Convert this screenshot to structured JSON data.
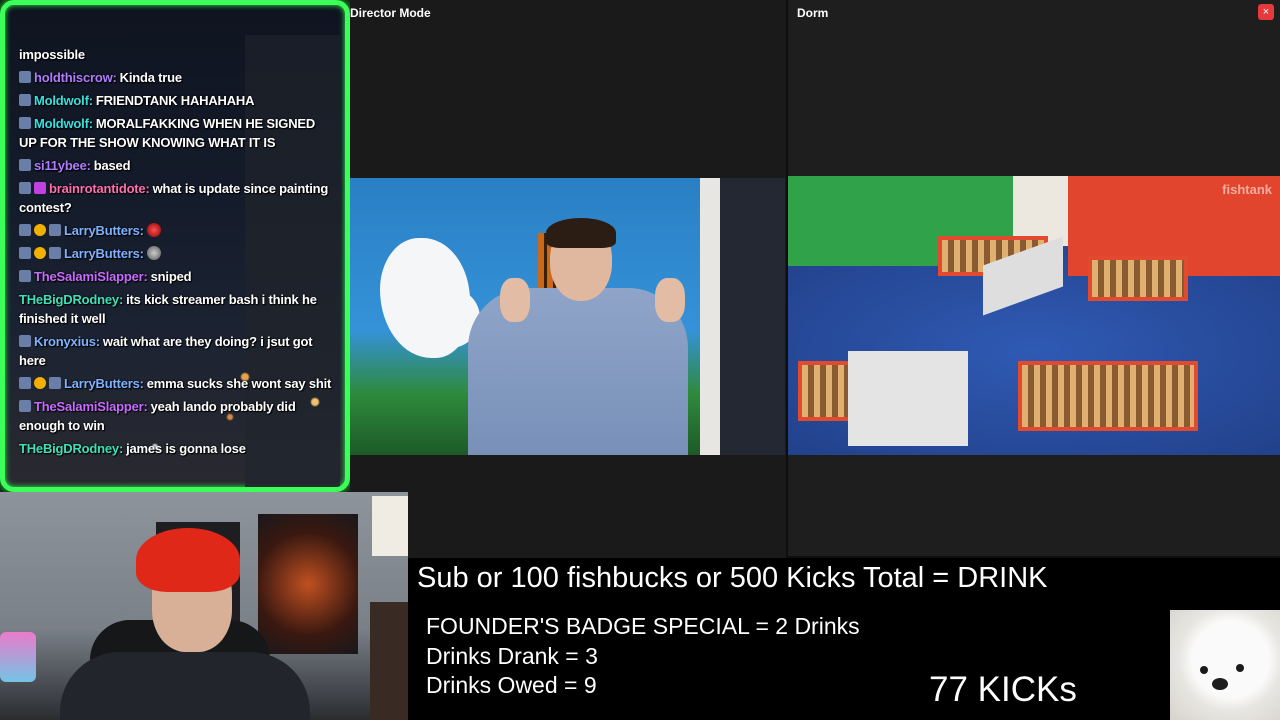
{
  "chat": {
    "messages": [
      {
        "user": "",
        "text": "impossible",
        "color": "#ffffff"
      },
      {
        "user": "holdthiscrow:",
        "text": "Kinda true",
        "color": "#b07cff"
      },
      {
        "user": "Moldwolf:",
        "text": "FRIENDTANK HAHAHAHA",
        "color": "#36e0e0"
      },
      {
        "user": "Moldwolf:",
        "text": "MORALFAKKING WHEN HE SIGNED UP FOR THE SHOW KNOWING WHAT IT IS",
        "color": "#36e0e0"
      },
      {
        "user": "si11ybee:",
        "text": "based",
        "color": "#b07cff"
      },
      {
        "user": "brainrotantidote:",
        "text": "what is update since painting contest?",
        "color": "#ff6fb0"
      },
      {
        "user": "LarryButters:",
        "text": "",
        "color": "#7eb2ff"
      },
      {
        "user": "LarryButters:",
        "text": "",
        "color": "#7eb2ff"
      },
      {
        "user": "TheSalamiSlapper:",
        "text": "sniped",
        "color": "#c86bff"
      },
      {
        "user": "THeBigDRodney:",
        "text": "its kick streamer bash i think he finished it well",
        "color": "#3fe0b8"
      },
      {
        "user": "Kronyxius:",
        "text": "wait what are they doing? i jsut got here",
        "color": "#7eb2ff"
      },
      {
        "user": "LarryButters:",
        "text": "emma sucks she wont say shit",
        "color": "#7eb2ff"
      },
      {
        "user": "TheSalamiSlapper:",
        "text": "yeah lando probably did enough to win",
        "color": "#c86bff"
      },
      {
        "user": "THeBigDRodney:",
        "text": "james is gonna lose",
        "color": "#3fe0b8"
      }
    ]
  },
  "director": {
    "title": "Director Mode"
  },
  "dorm": {
    "title": "Dorm",
    "close": "×",
    "watermark": "fishtank"
  },
  "overlay": {
    "rule": "Sub or 100 fishbucks or 500 Kicks Total = DRINK",
    "founder": "FOUNDER'S BADGE SPECIAL = 2 Drinks",
    "drank": "Drinks Drank = 3",
    "owed": "Drinks Owed = 9",
    "kicks": "77 KICKs"
  },
  "colors": {
    "chat_border": "#3dff5a",
    "close_button": "#e5393b"
  }
}
